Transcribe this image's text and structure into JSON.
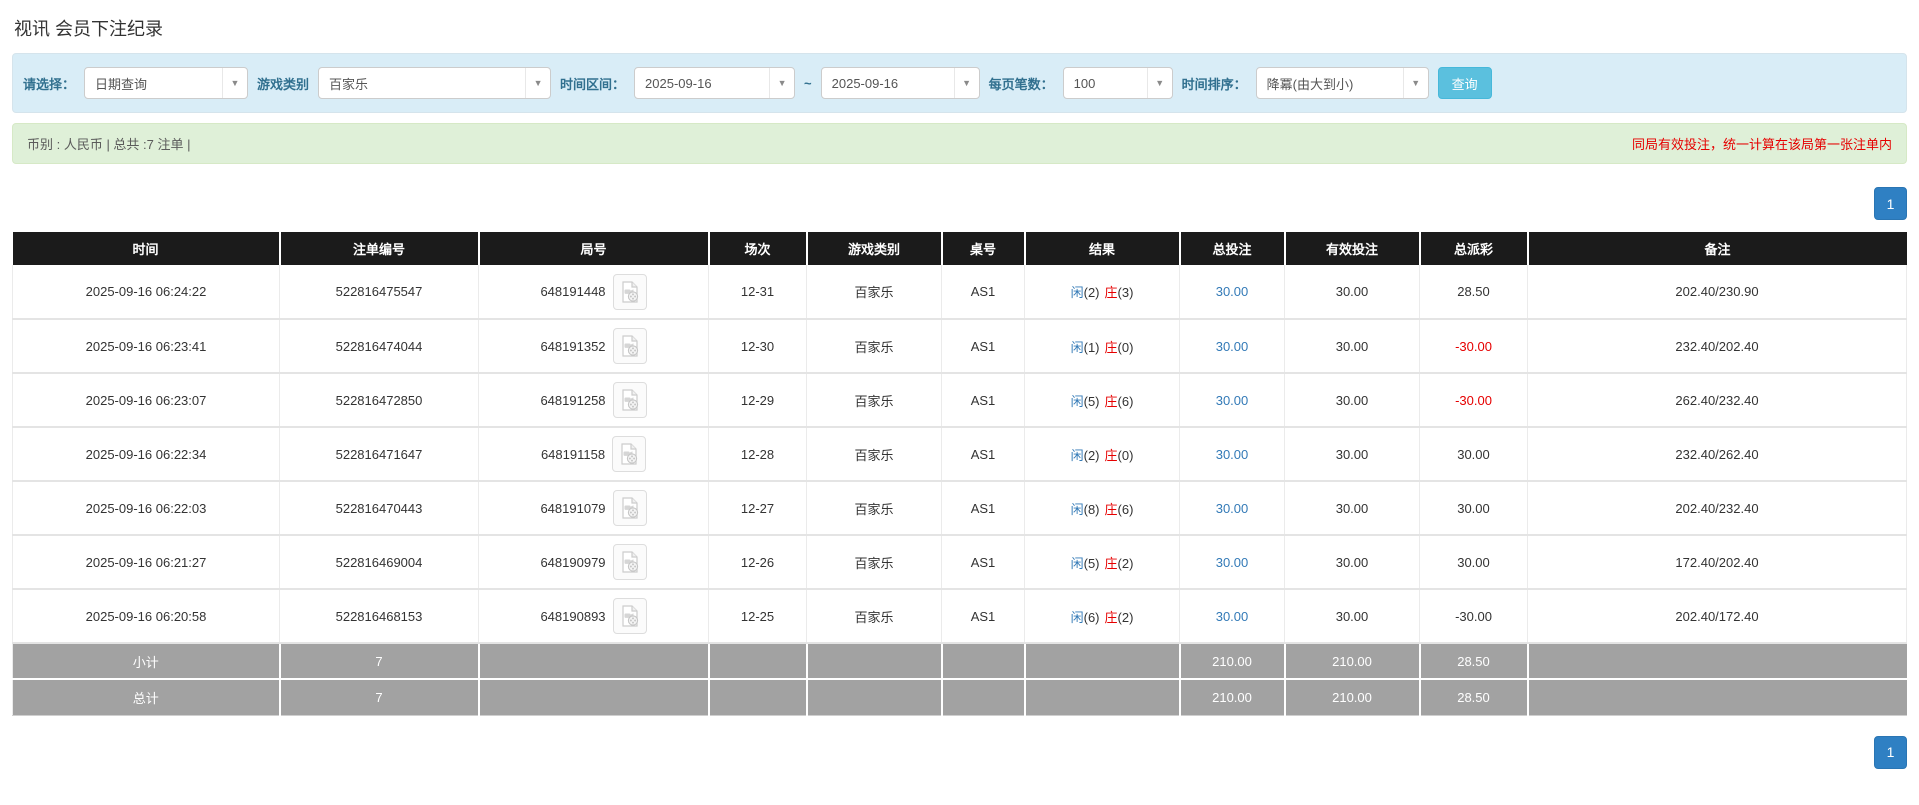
{
  "page": {
    "title": "视讯 会员下注纪录"
  },
  "filters": {
    "select_label": "请选择：",
    "select_value": "日期查询",
    "game_type_label": "游戏类别",
    "game_type_value": "百家乐",
    "time_range_label": "时间区间：",
    "date_from": "2025-09-16",
    "tilde": "~",
    "date_to": "2025-09-16",
    "page_size_label": "每页笔数：",
    "page_size_value": "100",
    "sort_label": "时间排序：",
    "sort_value": "降冪(由大到小)",
    "query_button": "查询"
  },
  "summary_bar": {
    "left_text": "币别 : 人民币 | 总共 :7 注单 |",
    "right_text": "同局有效投注，统一计算在该局第一张注单内"
  },
  "pagination": {
    "active_page": "1"
  },
  "icons": {
    "round_action": "video-record-icon",
    "dropdown": "caret-down-icon"
  },
  "colors": {
    "accent_blue": "#337ab7",
    "negative_red": "#e60000",
    "header_bg": "#1b1b1b",
    "summary_row_bg": "#a2a2a2",
    "filter_bg": "#d9edf7",
    "info_bar_bg": "#dff0d8",
    "query_btn_bg": "#5bc0de",
    "pager_bg": "#2f80c3"
  },
  "table": {
    "headers": [
      "时间",
      "注单编号",
      "局号",
      "场次",
      "游戏类别",
      "桌号",
      "结果",
      "总投注",
      "有效投注",
      "总派彩",
      "备注"
    ],
    "rows": [
      {
        "time": "2025-09-16 06:24:22",
        "bet_id": "522816475547",
        "round_id": "648191448",
        "session": "12-31",
        "game": "百家乐",
        "table_id": "AS1",
        "p_label": "闲",
        "p_num": "(2)",
        "b_label": "庄",
        "b_num": "(3)",
        "total_bet": "30.00",
        "valid_bet": "30.00",
        "payout": "28.50",
        "payout_negative": false,
        "remark": "202.40/230.90"
      },
      {
        "time": "2025-09-16 06:23:41",
        "bet_id": "522816474044",
        "round_id": "648191352",
        "session": "12-30",
        "game": "百家乐",
        "table_id": "AS1",
        "p_label": "闲",
        "p_num": "(1)",
        "b_label": "庄",
        "b_num": "(0)",
        "total_bet": "30.00",
        "valid_bet": "30.00",
        "payout": "-30.00",
        "payout_negative": true,
        "remark": "232.40/202.40"
      },
      {
        "time": "2025-09-16 06:23:07",
        "bet_id": "522816472850",
        "round_id": "648191258",
        "session": "12-29",
        "game": "百家乐",
        "table_id": "AS1",
        "p_label": "闲",
        "p_num": "(5)",
        "b_label": "庄",
        "b_num": "(6)",
        "total_bet": "30.00",
        "valid_bet": "30.00",
        "payout": "-30.00",
        "payout_negative": true,
        "remark": "262.40/232.40"
      },
      {
        "time": "2025-09-16 06:22:34",
        "bet_id": "522816471647",
        "round_id": "648191158",
        "session": "12-28",
        "game": "百家乐",
        "table_id": "AS1",
        "p_label": "闲",
        "p_num": "(2)",
        "b_label": "庄",
        "b_num": "(0)",
        "total_bet": "30.00",
        "valid_bet": "30.00",
        "payout": "30.00",
        "payout_negative": false,
        "remark": "232.40/262.40"
      },
      {
        "time": "2025-09-16 06:22:03",
        "bet_id": "522816470443",
        "round_id": "648191079",
        "session": "12-27",
        "game": "百家乐",
        "table_id": "AS1",
        "p_label": "闲",
        "p_num": "(8)",
        "b_label": "庄",
        "b_num": "(6)",
        "total_bet": "30.00",
        "valid_bet": "30.00",
        "payout": "30.00",
        "payout_negative": false,
        "remark": "202.40/232.40"
      },
      {
        "time": "2025-09-16 06:21:27",
        "bet_id": "522816469004",
        "round_id": "648190979",
        "session": "12-26",
        "game": "百家乐",
        "table_id": "AS1",
        "p_label": "闲",
        "p_num": "(5)",
        "b_label": "庄",
        "b_num": "(2)",
        "total_bet": "30.00",
        "valid_bet": "30.00",
        "payout": "30.00",
        "payout_negative": false,
        "remark": "172.40/202.40"
      },
      {
        "time": "2025-09-16 06:20:58",
        "bet_id": "522816468153",
        "round_id": "648190893",
        "session": "12-25",
        "game": "百家乐",
        "table_id": "AS1",
        "p_label": "闲",
        "p_num": "(6)",
        "b_label": "庄",
        "b_num": "(2)",
        "total_bet": "30.00",
        "valid_bet": "30.00",
        "payout": "-30.00",
        "payout_negative": false,
        "remark": "202.40/172.40"
      }
    ],
    "subtotal": {
      "label": "小计",
      "count": "7",
      "total_bet": "210.00",
      "valid_bet": "210.00",
      "payout": "28.50"
    },
    "total": {
      "label": "总计",
      "count": "7",
      "total_bet": "210.00",
      "valid_bet": "210.00",
      "payout": "28.50"
    }
  }
}
